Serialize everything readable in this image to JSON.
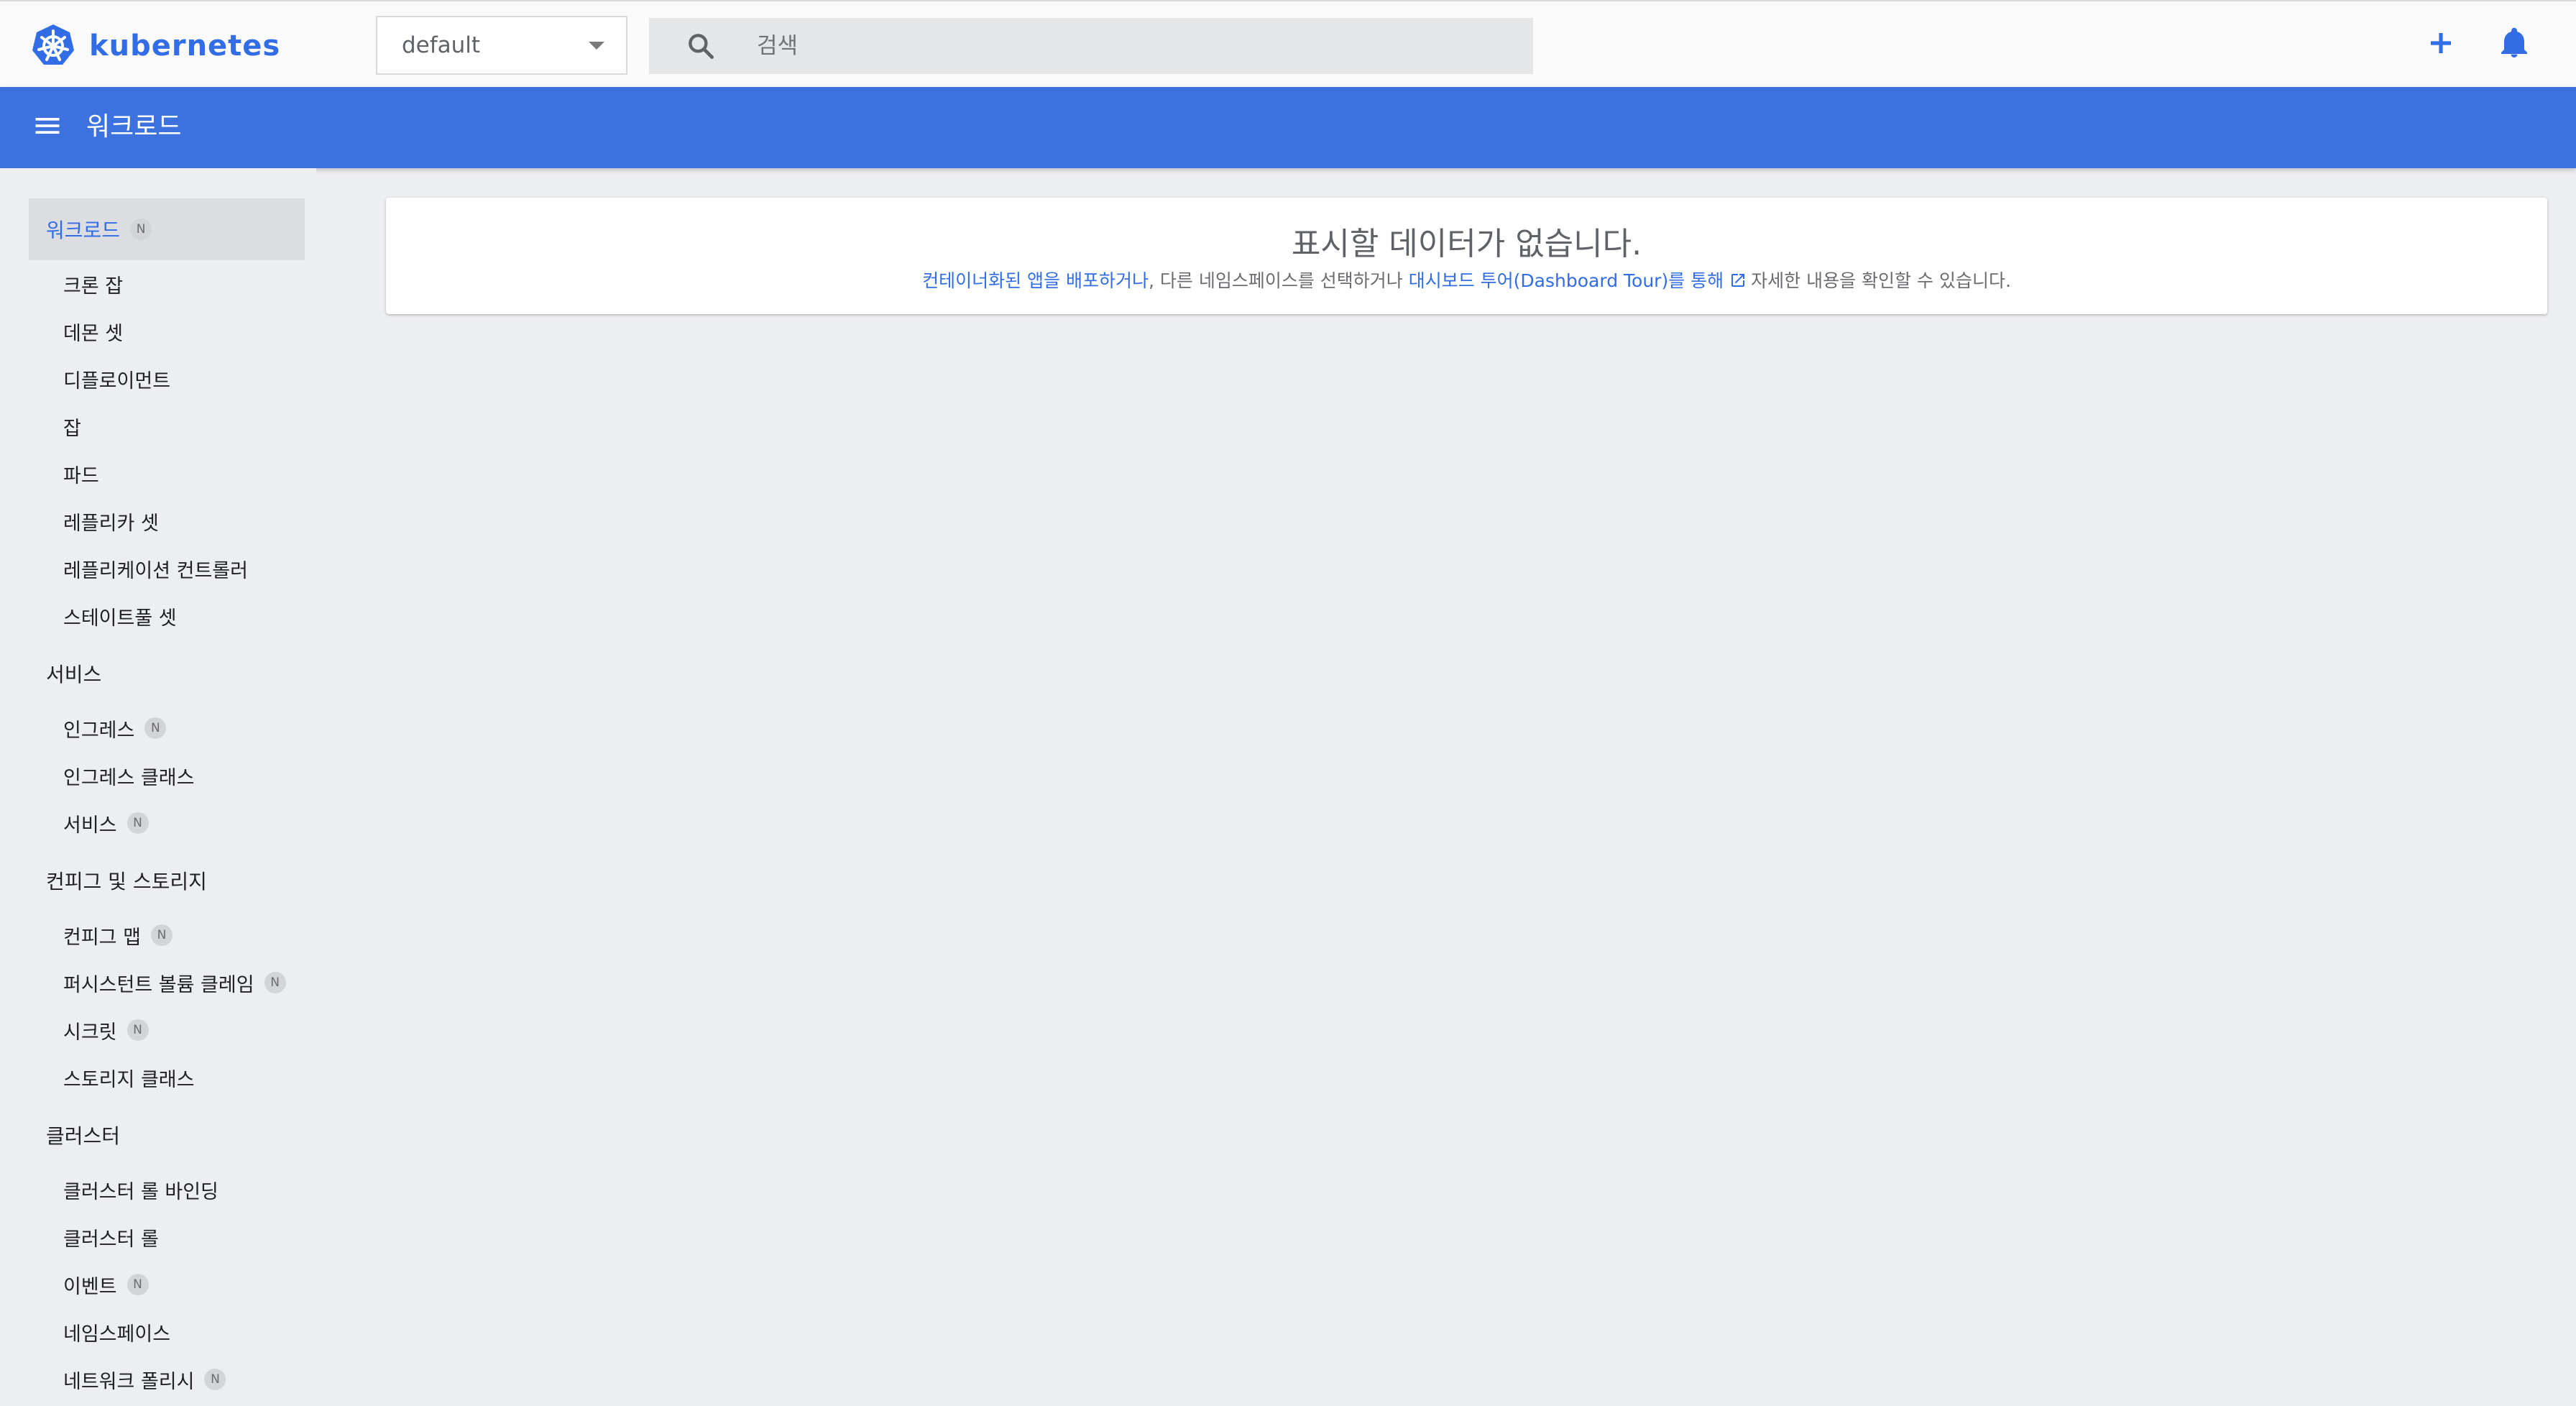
{
  "topbar": {
    "brand_name": "kubernetes",
    "namespace": "default",
    "search_placeholder": "검색",
    "icons": {
      "logo": "kubernetes-logo-icon",
      "caret": "dropdown-caret-icon",
      "search": "search-icon",
      "create": "plus-icon",
      "notifications": "bell-icon"
    }
  },
  "header": {
    "title": "워크로드",
    "menu_icon": "menu-icon"
  },
  "sidebar": {
    "workloads": {
      "label": "워크로드",
      "badge": "N",
      "items": [
        {
          "label": "크론 잡"
        },
        {
          "label": "데몬 셋"
        },
        {
          "label": "디플로이먼트"
        },
        {
          "label": "잡"
        },
        {
          "label": "파드"
        },
        {
          "label": "레플리카 셋"
        },
        {
          "label": "레플리케이션 컨트롤러"
        },
        {
          "label": "스테이트풀 셋"
        }
      ]
    },
    "service": {
      "label": "서비스",
      "items": [
        {
          "label": "인그레스",
          "badge": "N"
        },
        {
          "label": "인그레스 클래스"
        },
        {
          "label": "서비스",
          "badge": "N"
        }
      ]
    },
    "config": {
      "label": "컨피그 및 스토리지",
      "items": [
        {
          "label": "컨피그 맵",
          "badge": "N"
        },
        {
          "label": "퍼시스턴트 볼륨 클레임",
          "badge": "N"
        },
        {
          "label": "시크릿",
          "badge": "N"
        },
        {
          "label": "스토리지 클래스"
        }
      ]
    },
    "cluster": {
      "label": "클러스터",
      "items": [
        {
          "label": "클러스터 롤 바인딩"
        },
        {
          "label": "클러스터 롤"
        },
        {
          "label": "이벤트",
          "badge": "N"
        },
        {
          "label": "네임스페이스"
        },
        {
          "label": "네트워크 폴리시",
          "badge": "N"
        }
      ]
    }
  },
  "main": {
    "empty_title": "표시할 데이터가 없습니다.",
    "empty_link_deploy": "컨테이너화된 앱을 배포하거나",
    "empty_text_mid": ", 다른 네임스페이스를 선택하거나 ",
    "empty_link_tour": "대시보드 투어(Dashboard Tour)를 통해",
    "empty_text_end": "자세한 내용을 확인할 수 있습니다.",
    "external_icon": "external-link-icon"
  },
  "colors": {
    "brand_blue": "#326de6",
    "header_blue": "#3d72de",
    "background": "#edeef1"
  }
}
